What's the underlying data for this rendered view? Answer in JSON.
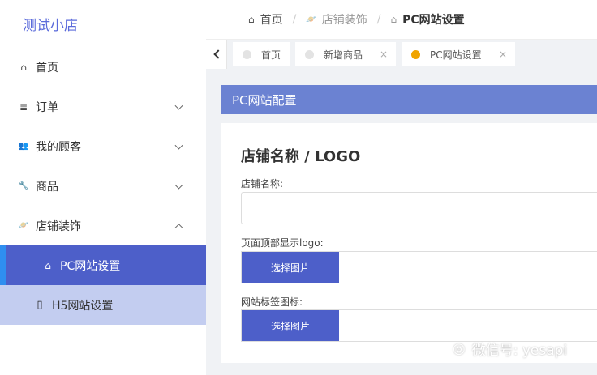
{
  "sidebar": {
    "brand": "测试小店",
    "items": [
      {
        "label": "首页",
        "icon": "home-icon",
        "glyph": "⌂"
      },
      {
        "label": "订单",
        "icon": "list-icon",
        "glyph": "≣"
      },
      {
        "label": "我的顾客",
        "icon": "people-icon",
        "glyph": "👥"
      },
      {
        "label": "商品",
        "icon": "wrench-icon",
        "glyph": "🔧"
      },
      {
        "label": "店铺装饰",
        "icon": "planet-icon",
        "glyph": "🪐"
      },
      {
        "label": "PC网站设置",
        "icon": "home-outline-icon",
        "glyph": "⌂"
      },
      {
        "label": "H5网站设置",
        "icon": "mobile-icon",
        "glyph": "▯"
      }
    ]
  },
  "breadcrumb": {
    "items": [
      {
        "label": "首页",
        "icon": "home-icon",
        "glyph": "⌂"
      },
      {
        "label": "店铺装饰",
        "icon": "planet-icon",
        "glyph": "🪐"
      },
      {
        "label": "PC网站设置",
        "icon": "home-outline-icon",
        "glyph": "⌂"
      }
    ],
    "separator": "/"
  },
  "tabs": [
    {
      "label": "首页",
      "active": false
    },
    {
      "label": "新增商品",
      "active": false,
      "close": "×"
    },
    {
      "label": "PC网站设置",
      "active": true,
      "close": "×"
    }
  ],
  "panel": {
    "header": "PC网站配置",
    "section_title": "店铺名称 / LOGO",
    "fields": {
      "shop_name_label": "店铺名称:",
      "shop_name_value": "",
      "top_logo_label": "页面顶部显示logo:",
      "favicon_label": "网站标签图标:",
      "upload_button": "选择图片"
    }
  },
  "watermark": {
    "text": "微信号: yesapi"
  },
  "colors": {
    "accent": "#4d5fc9",
    "panel_header": "#6b82d2",
    "active_tab_dot": "#f0a400",
    "brand_text": "#5b6bdb"
  }
}
